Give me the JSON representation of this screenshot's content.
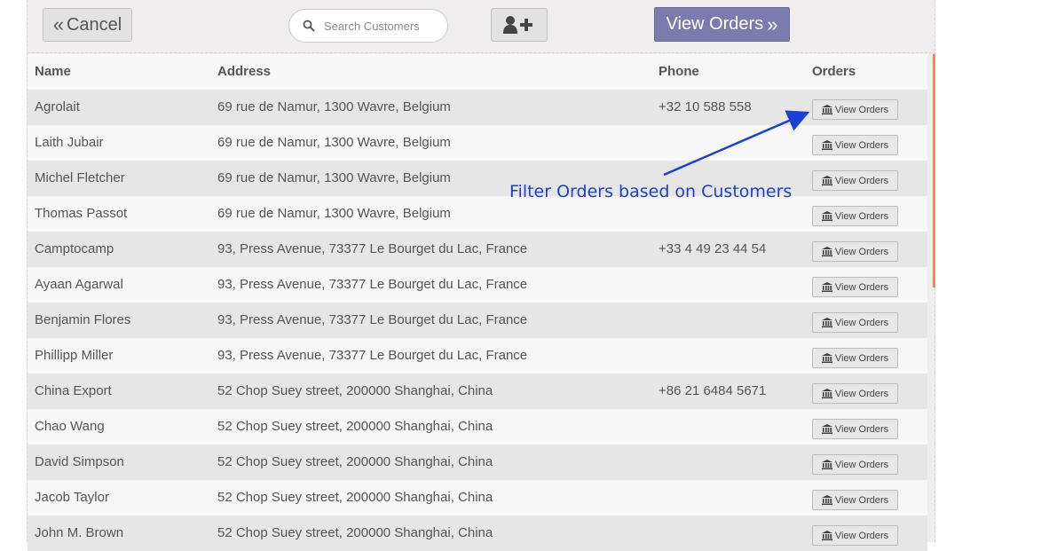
{
  "toolbar": {
    "cancel_label": "Cancel",
    "cancel_icon": "double-chevron-left",
    "search_placeholder": "Search Customers",
    "add_customer_icon": "user-plus",
    "view_orders_label": "View Orders",
    "view_orders_icon": "double-chevron-right",
    "view_orders_color": "#7c7bad"
  },
  "table": {
    "headers": {
      "name": "Name",
      "address": "Address",
      "phone": "Phone",
      "orders": "Orders"
    },
    "row_button_label": "View Orders",
    "rows": [
      {
        "name": "Agrolait",
        "address": "69 rue de Namur, 1300 Wavre, Belgium",
        "phone": "+32 10 588 558"
      },
      {
        "name": "Laith Jubair",
        "address": "69 rue de Namur, 1300 Wavre, Belgium",
        "phone": ""
      },
      {
        "name": "Michel Fletcher",
        "address": "69 rue de Namur, 1300 Wavre, Belgium",
        "phone": ""
      },
      {
        "name": "Thomas Passot",
        "address": "69 rue de Namur, 1300 Wavre, Belgium",
        "phone": ""
      },
      {
        "name": "Camptocamp",
        "address": "93, Press Avenue, 73377 Le Bourget du Lac, France",
        "phone": "+33 4 49 23 44 54"
      },
      {
        "name": "Ayaan Agarwal",
        "address": "93, Press Avenue, 73377 Le Bourget du Lac, France",
        "phone": ""
      },
      {
        "name": "Benjamin Flores",
        "address": "93, Press Avenue, 73377 Le Bourget du Lac, France",
        "phone": ""
      },
      {
        "name": "Phillipp Miller",
        "address": "93, Press Avenue, 73377 Le Bourget du Lac, France",
        "phone": ""
      },
      {
        "name": "China Export",
        "address": "52 Chop Suey street, 200000 Shanghai, China",
        "phone": "+86 21 6484 5671"
      },
      {
        "name": "Chao Wang",
        "address": "52 Chop Suey street, 200000 Shanghai, China",
        "phone": ""
      },
      {
        "name": "David Simpson",
        "address": "52 Chop Suey street, 200000 Shanghai, China",
        "phone": ""
      },
      {
        "name": "Jacob Taylor",
        "address": "52 Chop Suey street, 200000 Shanghai, China",
        "phone": ""
      },
      {
        "name": "John M. Brown",
        "address": "52 Chop Suey street, 200000 Shanghai, China",
        "phone": ""
      }
    ]
  },
  "annotation": {
    "text": "Filter Orders based on Customers",
    "color": "#1a3fd6"
  },
  "colors": {
    "background": "#efeded",
    "row_odd": "#e6e6e6",
    "row_even": "#f7f7f7",
    "scroll_indicator": "#f08a5d"
  }
}
